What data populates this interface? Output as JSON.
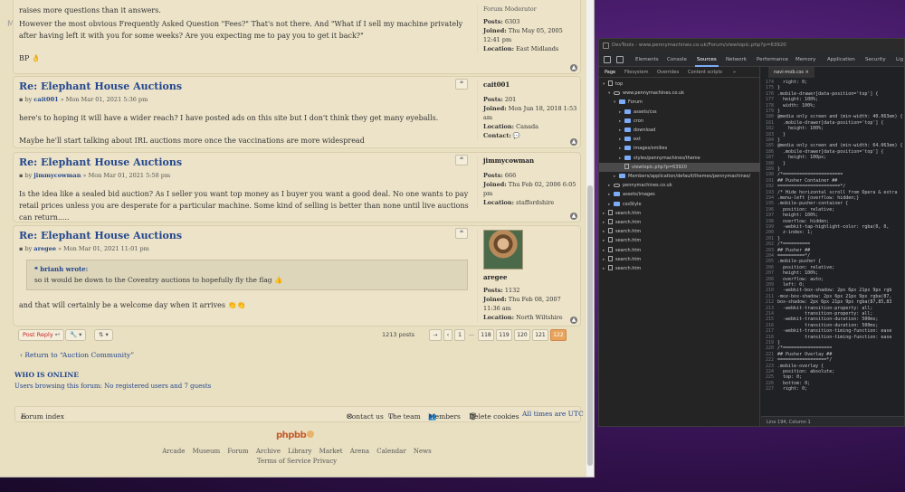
{
  "forum": {
    "menu_ghost": "MENU",
    "posts": [
      {
        "title": "",
        "byline_user": "",
        "byline_date": "",
        "paragraphs": [
          "raises more questions than it answers.",
          "However the most obvious Frequently Asked Question \"Fees?\" That's not there. And \"What if I sell my machine privately after having left it with you for some weeks? Are you expecting me to pay you to get it back?\"",
          "BP 👌"
        ],
        "profile": {
          "username": "",
          "rank": "Forum Moderator",
          "posts_label": "Posts:",
          "posts": "6303",
          "joined_label": "Joined:",
          "joined": "Thu May 05, 2005 12:41 pm",
          "location_label": "Location:",
          "location": "East Midlands"
        }
      },
      {
        "title": "Re: Elephant House Auctions",
        "byline_prefix": "by",
        "byline_user": "cait001",
        "byline_date": " » Mon Mar 01, 2021 5:36 pm",
        "paragraphs": [
          "here's to hoping it will have a wider reach? I have posted ads on this site but I don't think they get many eyeballs.",
          "Maybe he'll start talking about IRL auctions more once the vaccinations are more widespread"
        ],
        "profile": {
          "username": "cait001",
          "posts_label": "Posts:",
          "posts": "201",
          "joined_label": "Joined:",
          "joined": "Mon Jun 18, 2018 1:53 am",
          "location_label": "Location:",
          "location": "Canada",
          "contact_label": "Contact:"
        }
      },
      {
        "title": "Re: Elephant House Auctions",
        "byline_prefix": "by",
        "byline_user": "jimmycowman",
        "byline_date": " » Mon Mar 01, 2021 5:58 pm",
        "paragraphs": [
          "Is the idea like a sealed bid auction? As I seller you want top money as I buyer you want a good deal. No one wants to pay retail prices unless you are desperate for a particular machine. Some kind of selling is better than none until live auctions can return....."
        ],
        "profile": {
          "username": "jimmycowman",
          "posts_label": "Posts:",
          "posts": "666",
          "joined_label": "Joined:",
          "joined": "Thu Feb 02, 2006 6:05 pm",
          "location_label": "Location:",
          "location": "staffordshire"
        }
      },
      {
        "title": "Re: Elephant House Auctions",
        "byline_prefix": "by",
        "byline_user": "aregee",
        "byline_date": " » Mon Mar 01, 2021 11:01 pm",
        "quote_author": "brianh wrote:",
        "quote_text": "so it would be down to the Coventry auctions to hopefully fly the flag 👍",
        "paragraphs": [
          "and that will certainly be a welcome day when it arrives 👏👏"
        ],
        "profile": {
          "username": "aregee",
          "posts_label": "Posts:",
          "posts": "1132",
          "joined_label": "Joined:",
          "joined": "Thu Feb 08, 2007 11:36 am",
          "location_label": "Location:",
          "location": "North Wiltshire"
        }
      }
    ],
    "actions": {
      "post_reply": "Post Reply",
      "post_count": "1213 posts",
      "pages": [
        "1",
        "…",
        "118",
        "119",
        "120",
        "121",
        "122"
      ],
      "active_page": "122"
    },
    "return_link": "‹ Return to “Auction Community”",
    "who_online": {
      "title": "WHO IS ONLINE",
      "text": "Users browsing this forum: No registered users and 7 guests"
    },
    "footer": {
      "forum_index": "Forum index",
      "contact_us": "Contact us",
      "the_team": "The team",
      "members": "Members",
      "delete_cookies": "Delete cookies",
      "times": "All times are UTC"
    },
    "logo_text": "phpbb",
    "footer_links": [
      "Arcade",
      "Museum",
      "Forum",
      "Archive",
      "Library",
      "Market",
      "Arena",
      "Calendar",
      "News"
    ],
    "footer_links2": [
      "Terms of Service",
      "Privacy"
    ]
  },
  "devtools": {
    "title": "DevTools - www.pennymachines.co.uk/Forum/viewtopic.php?p=63920",
    "tabs": [
      "Elements",
      "Console",
      "Sources",
      "Network",
      "Performance",
      "Memory",
      "Application",
      "Security",
      "Lig"
    ],
    "active_tab": "Sources",
    "subtabs": [
      "Page",
      "Filesystem",
      "Overrides",
      "Content scripts",
      "»"
    ],
    "tree": [
      {
        "depth": 0,
        "type": "file",
        "arrow": "▾",
        "label": "top"
      },
      {
        "depth": 1,
        "type": "cloud",
        "arrow": "▾",
        "label": "www.pennymachines.co.uk"
      },
      {
        "depth": 2,
        "type": "folder",
        "arrow": "▾",
        "label": "Forum"
      },
      {
        "depth": 3,
        "type": "folder",
        "arrow": "▸",
        "label": "assets/css"
      },
      {
        "depth": 3,
        "type": "folder",
        "arrow": "▸",
        "label": "cron"
      },
      {
        "depth": 3,
        "type": "folder",
        "arrow": "▸",
        "label": "download"
      },
      {
        "depth": 3,
        "type": "folder",
        "arrow": "▸",
        "label": "ext"
      },
      {
        "depth": 3,
        "type": "folder",
        "arrow": "▸",
        "label": "images/smilies"
      },
      {
        "depth": 3,
        "type": "folder",
        "arrow": "▸",
        "label": "styles/pennymachines/theme"
      },
      {
        "depth": 3,
        "type": "file",
        "arrow": "",
        "label": "viewtopic.php?p=63920",
        "selected": true
      },
      {
        "depth": 2,
        "type": "folder",
        "arrow": "▸",
        "label": "Members/application/default/themes/pennymachines/"
      },
      {
        "depth": 1,
        "type": "cloud",
        "arrow": "▸",
        "label": "pennymachines.co.uk"
      },
      {
        "depth": 1,
        "type": "folder",
        "arrow": "▸",
        "label": "assets/images"
      },
      {
        "depth": 1,
        "type": "folder",
        "arrow": "▸",
        "label": "cssStyle"
      },
      {
        "depth": 0,
        "type": "file",
        "arrow": "▸",
        "label": "search.htm"
      },
      {
        "depth": 0,
        "type": "file",
        "arrow": "▸",
        "label": "search.htm"
      },
      {
        "depth": 0,
        "type": "file",
        "arrow": "▸",
        "label": "search.htm"
      },
      {
        "depth": 0,
        "type": "file",
        "arrow": "▸",
        "label": "search.htm"
      },
      {
        "depth": 0,
        "type": "file",
        "arrow": "▸",
        "label": "search.htm"
      },
      {
        "depth": 0,
        "type": "file",
        "arrow": "▸",
        "label": "search.htm"
      },
      {
        "depth": 0,
        "type": "file",
        "arrow": "▸",
        "label": "search.htm"
      }
    ],
    "code_file": "navi-mob.css ×",
    "code": [
      {
        "n": "174",
        "t": "  right: 0;"
      },
      {
        "n": "175",
        "t": "}"
      },
      {
        "n": "176",
        "t": ".mobile-drawer[data-position='top'] {"
      },
      {
        "n": "177",
        "t": "  height: 100%;"
      },
      {
        "n": "178",
        "t": "  width: 100%;"
      },
      {
        "n": "179",
        "t": "}"
      },
      {
        "n": "180",
        "t": "@media only screen and (min-width: 40.063em) {"
      },
      {
        "n": "181",
        "t": "  .mobile-drawer[data-position='top'] {"
      },
      {
        "n": "182",
        "t": "    height: 100%;"
      },
      {
        "n": "183",
        "t": "  }"
      },
      {
        "n": "184",
        "t": "}"
      },
      {
        "n": "185",
        "t": "@media only screen and (min-width: 64.063em) {"
      },
      {
        "n": "186",
        "t": "  .mobile-drawer[data-position='top'] {"
      },
      {
        "n": "187",
        "t": "    height: 100px;"
      },
      {
        "n": "188",
        "t": "  }"
      },
      {
        "n": "189",
        "t": "}"
      },
      {
        "n": "190",
        "t": "/*======================"
      },
      {
        "n": "191",
        "t": "## Pusher Container ##"
      },
      {
        "n": "192",
        "t": "=======================*/"
      },
      {
        "n": "193",
        "t": "/* Hide horizontal scroll from Opera & extra"
      },
      {
        "n": "194",
        "t": ".menu-left {overflow: hidden;}"
      },
      {
        "n": "195",
        "t": ".mobile-pusher-container {"
      },
      {
        "n": "196",
        "t": "  position: relative;"
      },
      {
        "n": "197",
        "t": "  height: 100%;"
      },
      {
        "n": "198",
        "t": "  overflow: hidden;"
      },
      {
        "n": "199",
        "t": "  -webkit-tap-highlight-color: rgba(0, 0,"
      },
      {
        "n": "200",
        "t": "  z-index: 1;"
      },
      {
        "n": "201",
        "t": "}"
      },
      {
        "n": "202",
        "t": "/*=========="
      },
      {
        "n": "203",
        "t": "## Pusher ##"
      },
      {
        "n": "204",
        "t": "==========*/"
      },
      {
        "n": "205",
        "t": ".mobile-pusher {"
      },
      {
        "n": "206",
        "t": "  position: relative;"
      },
      {
        "n": "207",
        "t": "  height: 100%;"
      },
      {
        "n": "208",
        "t": "  overflow: auto;"
      },
      {
        "n": "209",
        "t": "  left: 0;"
      },
      {
        "n": "210",
        "t": "  -webkit-box-shadow: 2px 6px 21px 9px rgb"
      },
      {
        "n": "211",
        "t": "-moz-box-shadow: 2px 6px 21px 9px rgba(87,"
      },
      {
        "n": "212",
        "t": "box-shadow: 2px 6px 21px 9px rgba(87,85,83"
      },
      {
        "n": "213",
        "t": "  -webkit-transition-property: all;"
      },
      {
        "n": "214",
        "t": "          transition-property: all;"
      },
      {
        "n": "215",
        "t": "  -webkit-transition-duration: 500ms;"
      },
      {
        "n": "216",
        "t": "          transition-duration: 500ms;"
      },
      {
        "n": "217",
        "t": "  -webkit-transition-timing-function: ease"
      },
      {
        "n": "218",
        "t": "          transition-timing-function: ease"
      },
      {
        "n": "219",
        "t": "}"
      },
      {
        "n": "220",
        "t": "/*=================="
      },
      {
        "n": "221",
        "t": "## Pusher Overlay ##"
      },
      {
        "n": "222",
        "t": "==================*/"
      },
      {
        "n": "223",
        "t": ".mobile-overlay {"
      },
      {
        "n": "224",
        "t": "  position: absolute;"
      },
      {
        "n": "225",
        "t": "  top: 0;"
      },
      {
        "n": "226",
        "t": "  bottom: 0;"
      },
      {
        "n": "227",
        "t": "  right: 0;"
      }
    ],
    "status": "Line 194, Column 1"
  }
}
